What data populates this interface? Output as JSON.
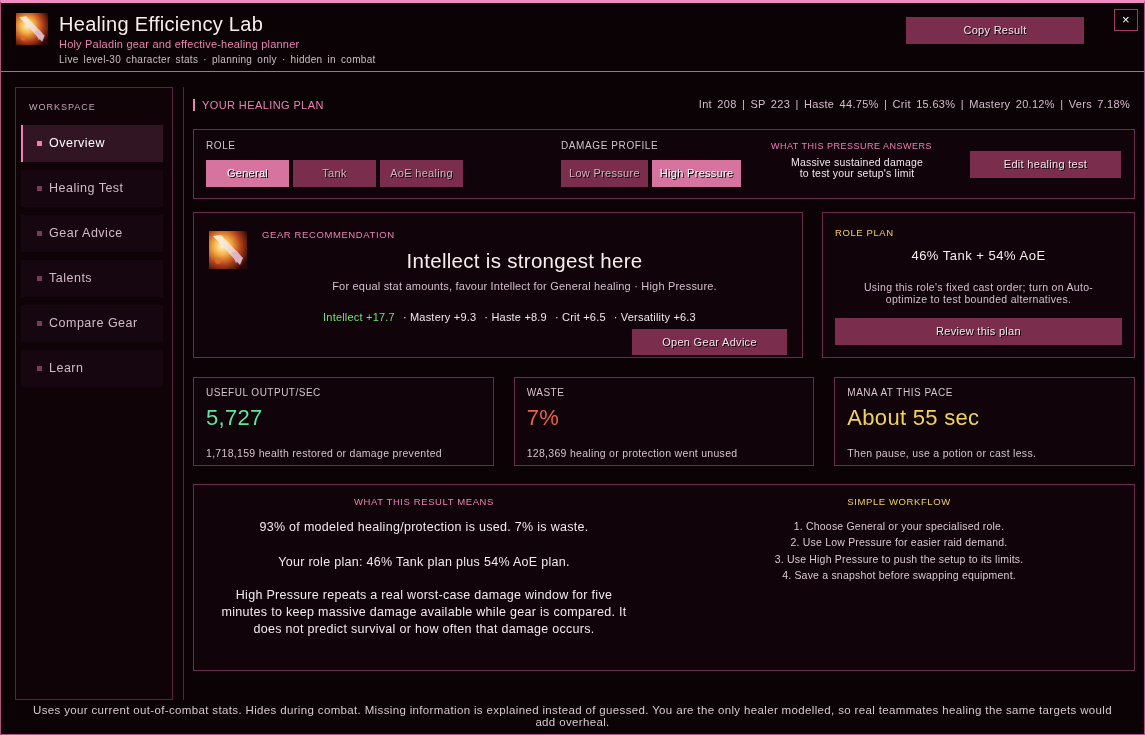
{
  "window": {
    "title": "Healing Efficiency Lab",
    "subtitle": "Holy Paladin gear and effective-healing planner",
    "meta": "Live level-30 character stats · planning only · hidden in combat",
    "action": "Copy Result",
    "close": "×"
  },
  "sidebar": {
    "heading": "WORKSPACE",
    "items": [
      {
        "label": "Overview",
        "selected": true
      },
      {
        "label": "Healing Test",
        "selected": false
      },
      {
        "label": "Gear Advice",
        "selected": false
      },
      {
        "label": "Talents",
        "selected": false
      },
      {
        "label": "Compare Gear",
        "selected": false
      },
      {
        "label": "Learn",
        "selected": false
      }
    ]
  },
  "plan": {
    "heading": "YOUR HEALING PLAN",
    "stats": "Int 208 | SP 223 | Haste 44.75% | Crit 15.63% | Mastery 20.12% | Vers 7.18%"
  },
  "controls": {
    "role": {
      "label": "ROLE",
      "options": [
        {
          "label": "General",
          "selected": true
        },
        {
          "label": "Tank",
          "selected": false
        },
        {
          "label": "AoE healing",
          "selected": false
        }
      ]
    },
    "damage_profile": {
      "label": "DAMAGE PROFILE",
      "options": [
        {
          "label": "Low Pressure",
          "selected": false
        },
        {
          "label": "High Pressure",
          "selected": true
        }
      ]
    },
    "pressure_answer": {
      "heading": "WHAT THIS PRESSURE ANSWERS",
      "text": "Massive sustained damage to test your setup's limit"
    },
    "button": "Edit healing test"
  },
  "gear_recommendation": {
    "heading": "GEAR RECOMMENDATION",
    "title": "Intellect is strongest here",
    "description": "For equal stat amounts, favour Intellect for General healing · High Pressure.",
    "stat_weights": [
      {
        "text": "Intellect +17.7",
        "best": true
      },
      {
        "text": "· Mastery +9.3",
        "best": false
      },
      {
        "text": "· Haste +8.9",
        "best": false
      },
      {
        "text": "· Crit +6.5",
        "best": false
      },
      {
        "text": "· Versatility +6.3",
        "best": false
      }
    ],
    "button": "Open Gear Advice"
  },
  "role_plan": {
    "heading": "ROLE PLAN",
    "summary": "46% Tank + 54% AoE",
    "note": "Using this role's fixed cast order; turn on Auto-optimize to test bounded alternatives.",
    "button": "Review this plan"
  },
  "metrics": [
    {
      "label": "USEFUL OUTPUT/SEC",
      "value": "5,727",
      "color": "#5ce6a4",
      "detail": "1,718,159 health restored or damage prevented"
    },
    {
      "label": "WASTE",
      "value": "7%",
      "color": "#e8624c",
      "detail": "128,369 healing or protection went unused"
    },
    {
      "label": "MANA AT THIS PACE",
      "value": "About 55 sec",
      "color": "#f2d35a",
      "detail": "Then pause, use a potion or cast less."
    }
  ],
  "result_explanation": {
    "heading": "WHAT THIS RESULT MEANS",
    "paragraphs": [
      "93% of modeled healing/protection is used. 7% is waste.",
      "Your role plan: 46% Tank plan plus 54% AoE plan.",
      "High Pressure repeats a real worst-case damage window for five minutes to keep massive damage available while gear is compared. It does not predict survival or how often that damage occurs."
    ]
  },
  "workflow": {
    "heading": "SIMPLE WORKFLOW",
    "steps": [
      "1. Choose General or your specialised role.",
      "2. Use Low Pressure for easier raid demand.",
      "3. Use High Pressure to push the setup to its limits.",
      "4. Save a snapshot before swapping equipment."
    ]
  },
  "footer": "Uses your current out-of-combat stats. Hides during combat. Missing information is explained instead of guessed. You are the only healer modelled, so real teammates healing the same targets would add overheal."
}
